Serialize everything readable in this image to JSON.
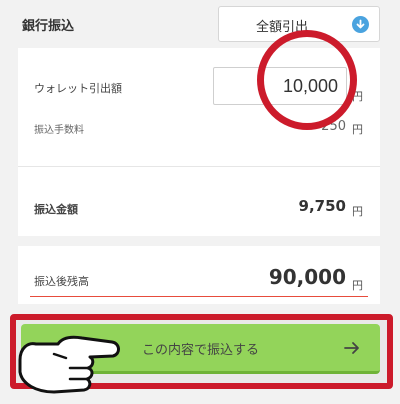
{
  "header": {
    "title": "銀行振込",
    "select": {
      "value": "全額引出",
      "icon": "chevron-down-icon"
    }
  },
  "form": {
    "wallet_withdrawal": {
      "label": "ウォレット引出額",
      "value": "10,000",
      "unit": "円"
    },
    "fee": {
      "label": "振込手数料",
      "value": "-250",
      "unit": "円"
    },
    "transfer_amount": {
      "label": "振込金額",
      "value": "9,750",
      "unit": "円"
    },
    "balance_after": {
      "label": "振込後残高",
      "value": "90,000",
      "unit": "円"
    }
  },
  "cta": {
    "label": "この内容で振込する",
    "icon": "arrow-right-icon"
  },
  "colors": {
    "highlight": "#cc1b2b",
    "cta": "#93d45a",
    "accent": "#4aa3df",
    "underline": "#e74c3c"
  }
}
